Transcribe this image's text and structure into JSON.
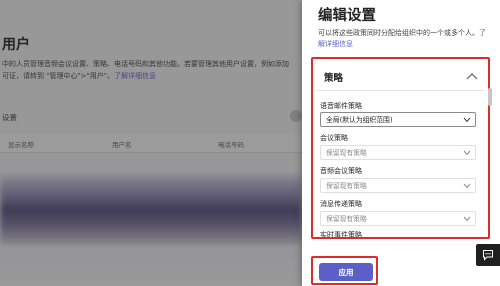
{
  "background": {
    "title": "用户",
    "description_line1": "中的人员管理音频会议设置、策略、电话号码和其他功能。若要管理其他用户设置，例如添加",
    "description_line2_prefix": "可证，请转到 \"管理中心\">\"用户\"。",
    "description_link": "了解详细信息",
    "section_title": "设置",
    "columns": [
      "显示名称",
      "用户名",
      "电话号码"
    ]
  },
  "panel": {
    "title": "编辑设置",
    "description": "可以将这些政策同时分配给组织中的一个或多个人。",
    "learn_more": "了解详细信息",
    "policies": {
      "header": "策略",
      "fields": [
        {
          "label": "语音邮件策略",
          "value": "全局(默认为组织范围)"
        },
        {
          "label": "会议策略",
          "value": "保留现有策略"
        },
        {
          "label": "音频会议策略",
          "value": "保留现有策略"
        },
        {
          "label": "消息传递策略",
          "value": "保留现有策略"
        },
        {
          "label": "实时事件策略",
          "value": ""
        }
      ]
    },
    "apply_label": "应用"
  },
  "colors": {
    "accent": "#5b5fc7",
    "highlight": "#d92c2c"
  }
}
